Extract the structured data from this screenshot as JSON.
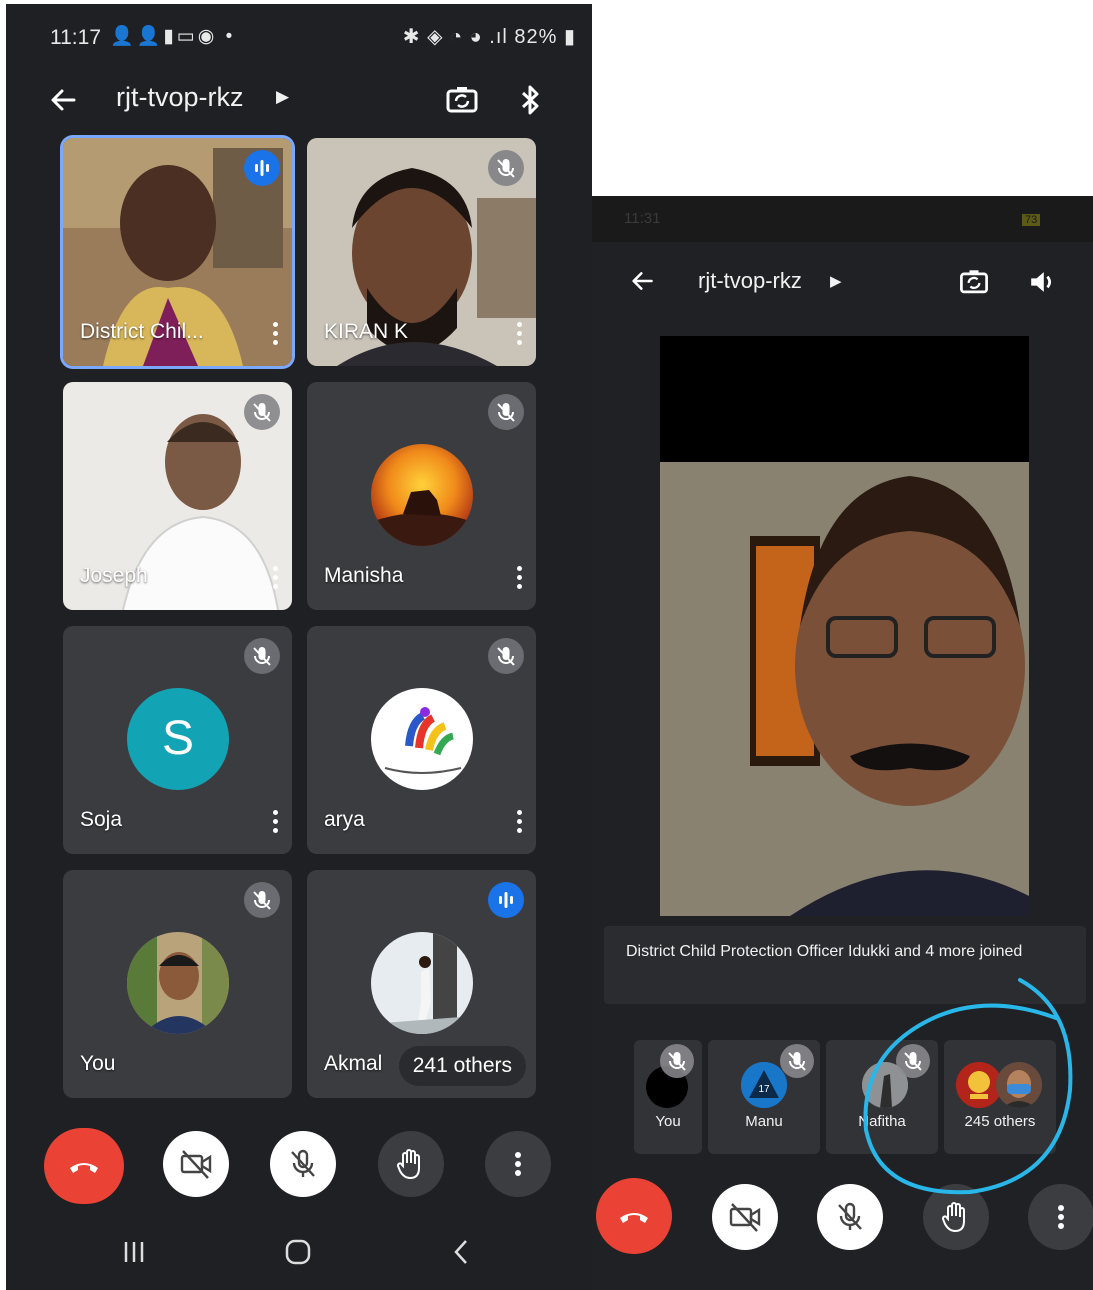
{
  "left": {
    "status": {
      "time": "11:17",
      "battery": "82%"
    },
    "meeting_code": "rjt-tvop-rkz",
    "tiles": [
      {
        "name": "District Chil...",
        "speaking": true
      },
      {
        "name": "KIRAN K",
        "muted": true
      },
      {
        "name": "Joseph",
        "muted": true
      },
      {
        "name": "Manisha",
        "muted": true
      },
      {
        "name": "Soja",
        "muted": true,
        "initial": "S",
        "avatar_color": "#12a4b4"
      },
      {
        "name": "arya",
        "muted": true
      },
      {
        "name": "You",
        "muted": true
      },
      {
        "name": "Akmal",
        "speaking": true,
        "others": "241 others"
      }
    ]
  },
  "right": {
    "status": {
      "time": "11:31",
      "battery": "73"
    },
    "meeting_code": "rjt-tvop-rkz",
    "notice": "District Child Protection Officer Idukki and 4 more joined",
    "participants": [
      {
        "name": "You"
      },
      {
        "name": "Manu"
      },
      {
        "name": "Nafitha"
      },
      {
        "name": "245 others"
      }
    ]
  },
  "colors": {
    "end_call": "#ea4335",
    "speaking": "#1a73e8",
    "annotation": "#29b6e8"
  }
}
